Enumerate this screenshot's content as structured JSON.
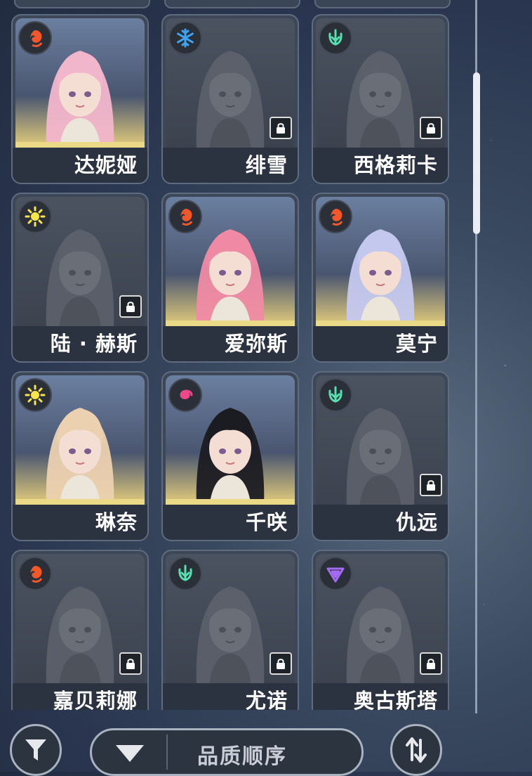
{
  "characters": [
    {
      "name": "达妮娅",
      "element": "fire-icon",
      "locked": false,
      "hair": "#f2b6cc"
    },
    {
      "name": "绯雪",
      "element": "ice-icon",
      "locked": true,
      "hair": "#b9bdc4"
    },
    {
      "name": "西格莉卡",
      "element": "wind-icon",
      "locked": true,
      "hair": "#e39a54"
    },
    {
      "name": "陆 · 赫斯",
      "element": "light-icon",
      "locked": true,
      "hair": "#c9b27a"
    },
    {
      "name": "爱弥斯",
      "element": "fire-icon",
      "locked": false,
      "hair": "#f08aa4"
    },
    {
      "name": "莫宁",
      "element": "fire-icon",
      "locked": false,
      "hair": "#c4c8ee"
    },
    {
      "name": "琳奈",
      "element": "light-icon",
      "locked": false,
      "hair": "#ecd1b0"
    },
    {
      "name": "千咲",
      "element": "spiral-icon",
      "locked": false,
      "hair": "#1b1b22"
    },
    {
      "name": "仇远",
      "element": "wind-icon",
      "locked": true,
      "hair": "#3e3e3e"
    },
    {
      "name": "嘉贝莉娜",
      "element": "fire-icon",
      "locked": true,
      "hair": "#bcbcc4"
    },
    {
      "name": "尤诺",
      "element": "wind-icon",
      "locked": true,
      "hair": "#2e3d78"
    },
    {
      "name": "奥古斯塔",
      "element": "havoc-icon",
      "locked": true,
      "hair": "#d35a2c"
    }
  ],
  "element_colors": {
    "fire-icon": "#f0582c",
    "ice-icon": "#3fa4f2",
    "wind-icon": "#56e0b0",
    "light-icon": "#f7e64a",
    "spiral-icon": "#f0478a",
    "havoc-icon": "#a56bf5"
  },
  "footer": {
    "filter_icon": "filter-icon",
    "sort_label": "品质顺序",
    "sort_order_icon": "sort-order-icon"
  }
}
